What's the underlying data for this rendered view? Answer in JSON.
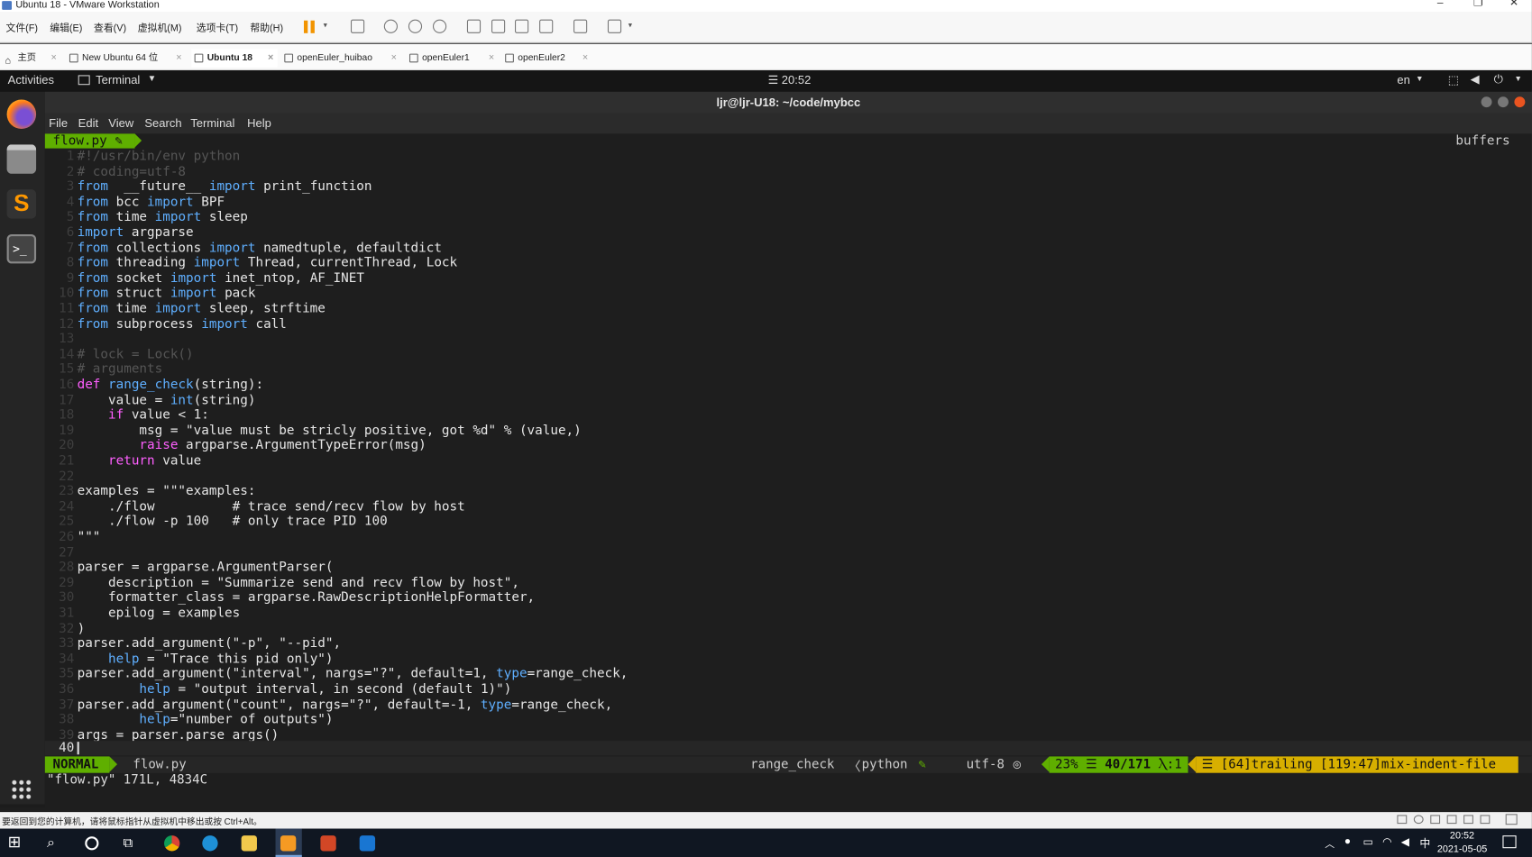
{
  "window": {
    "title": "Ubuntu 18 - VMware Workstation"
  },
  "vm_menu": [
    "文件(F)",
    "编辑(E)",
    "查看(V)",
    "虚拟机(M)",
    "选项卡(T)",
    "帮助(H)"
  ],
  "vm_tabs": [
    {
      "label": "主页"
    },
    {
      "label": "New Ubuntu 64 位"
    },
    {
      "label": "Ubuntu 18"
    },
    {
      "label": "openEuler_huibao"
    },
    {
      "label": "openEuler1"
    },
    {
      "label": "openEuler2"
    }
  ],
  "gnome": {
    "activities": "Activities",
    "app": "Terminal",
    "clock": "20:52",
    "lang": "en"
  },
  "terminal": {
    "title": "ljr@ljr-U18: ~/code/mybcc",
    "menu": [
      "File",
      "Edit",
      "View",
      "Search",
      "Terminal",
      "Help"
    ]
  },
  "vim": {
    "tab": "flow.py",
    "buffers_label": "buffers",
    "mode": "NORMAL",
    "filename": "flow.py",
    "func": "range_check",
    "filetype": "python",
    "encoding": "utf-8",
    "percent": "23%",
    "position": "40/171",
    "col": ":1",
    "warnings": "[64]trailing [119:47]mix-indent-file",
    "cmdline": "\"flow.py\" 171L, 4834C",
    "cursor_line": "40"
  },
  "code_lines": [
    {
      "n": "1",
      "t": "#!/usr/bin/env python",
      "c": "cm"
    },
    {
      "n": "2",
      "t": "# coding=utf-8",
      "c": "cm"
    },
    {
      "n": "3",
      "parts": [
        [
          "kw",
          "from"
        ],
        [
          "",
          "  __future__ "
        ],
        [
          "kw",
          "import"
        ],
        [
          "",
          " print_function"
        ]
      ]
    },
    {
      "n": "4",
      "parts": [
        [
          "kw",
          "from"
        ],
        [
          "",
          " bcc "
        ],
        [
          "kw",
          "import"
        ],
        [
          "",
          " BPF"
        ]
      ]
    },
    {
      "n": "5",
      "parts": [
        [
          "kw",
          "from"
        ],
        [
          "",
          " time "
        ],
        [
          "kw",
          "import"
        ],
        [
          "",
          " sleep"
        ]
      ]
    },
    {
      "n": "6",
      "parts": [
        [
          "kw",
          "import"
        ],
        [
          "",
          " argparse"
        ]
      ]
    },
    {
      "n": "7",
      "parts": [
        [
          "kw",
          "from"
        ],
        [
          "",
          " collections "
        ],
        [
          "kw",
          "import"
        ],
        [
          "",
          " namedtuple, defaultdict"
        ]
      ]
    },
    {
      "n": "8",
      "parts": [
        [
          "kw",
          "from"
        ],
        [
          "",
          " threading "
        ],
        [
          "kw",
          "import"
        ],
        [
          "",
          " Thread, currentThread, Lock"
        ]
      ]
    },
    {
      "n": "9",
      "parts": [
        [
          "kw",
          "from"
        ],
        [
          "",
          " socket "
        ],
        [
          "kw",
          "import"
        ],
        [
          "",
          " inet_ntop, AF_INET"
        ]
      ]
    },
    {
      "n": "10",
      "parts": [
        [
          "kw",
          "from"
        ],
        [
          "",
          " struct "
        ],
        [
          "kw",
          "import"
        ],
        [
          "",
          " pack"
        ]
      ]
    },
    {
      "n": "11",
      "parts": [
        [
          "kw",
          "from"
        ],
        [
          "",
          " time "
        ],
        [
          "kw",
          "import"
        ],
        [
          "",
          " sleep, strftime"
        ]
      ]
    },
    {
      "n": "12",
      "parts": [
        [
          "kw",
          "from"
        ],
        [
          "",
          " subprocess "
        ],
        [
          "kw",
          "import"
        ],
        [
          "",
          " call"
        ]
      ]
    },
    {
      "n": "13",
      "t": "",
      "c": ""
    },
    {
      "n": "14",
      "t": "# lock = Lock()",
      "c": "cm"
    },
    {
      "n": "15",
      "t": "# arguments",
      "c": "cm"
    },
    {
      "n": "16",
      "parts": [
        [
          "kw2",
          "def"
        ],
        [
          "",
          " "
        ],
        [
          "bi",
          "range_check"
        ],
        [
          "",
          "(string):"
        ]
      ]
    },
    {
      "n": "17",
      "parts": [
        [
          "",
          "    value = "
        ],
        [
          "bi",
          "int"
        ],
        [
          "",
          "(string)"
        ]
      ]
    },
    {
      "n": "18",
      "parts": [
        [
          "",
          "    "
        ],
        [
          "kw2",
          "if"
        ],
        [
          "",
          " value < 1:"
        ]
      ]
    },
    {
      "n": "19",
      "t": "        msg = \"value must be stricly positive, got %d\" % (value,)",
      "c": ""
    },
    {
      "n": "20",
      "parts": [
        [
          "",
          "        "
        ],
        [
          "kw2",
          "raise"
        ],
        [
          "",
          " argparse.ArgumentTypeError(msg)"
        ]
      ]
    },
    {
      "n": "21",
      "parts": [
        [
          "",
          "    "
        ],
        [
          "kw2",
          "return"
        ],
        [
          "",
          " value"
        ]
      ]
    },
    {
      "n": "22",
      "t": "",
      "c": ""
    },
    {
      "n": "23",
      "t": "examples = \"\"\"examples:",
      "c": ""
    },
    {
      "n": "24",
      "t": "    ./flow          # trace send/recv flow by host",
      "c": ""
    },
    {
      "n": "25",
      "t": "    ./flow -p 100   # only trace PID 100",
      "c": ""
    },
    {
      "n": "26",
      "t": "\"\"\"",
      "c": ""
    },
    {
      "n": "27",
      "t": "",
      "c": ""
    },
    {
      "n": "28",
      "t": "parser = argparse.ArgumentParser(",
      "c": ""
    },
    {
      "n": "29",
      "t": "    description = \"Summarize send and recv flow by host\",",
      "c": ""
    },
    {
      "n": "30",
      "t": "    formatter_class = argparse.RawDescriptionHelpFormatter,",
      "c": ""
    },
    {
      "n": "31",
      "t": "    epilog = examples",
      "c": ""
    },
    {
      "n": "32",
      "t": ")",
      "c": ""
    },
    {
      "n": "33",
      "t": "parser.add_argument(\"-p\", \"--pid\",",
      "c": ""
    },
    {
      "n": "34",
      "parts": [
        [
          "",
          "    "
        ],
        [
          "kw",
          "help"
        ],
        [
          "",
          " = \"Trace this pid only\")"
        ]
      ]
    },
    {
      "n": "35",
      "parts": [
        [
          "",
          "parser.add_argument(\"interval\", nargs=\"?\", default=1, "
        ],
        [
          "kw",
          "type"
        ],
        [
          "",
          "=range_check,"
        ]
      ]
    },
    {
      "n": "36",
      "parts": [
        [
          "",
          "        "
        ],
        [
          "kw",
          "help"
        ],
        [
          "",
          " = \"output interval, in second (default 1)\")"
        ]
      ]
    },
    {
      "n": "37",
      "parts": [
        [
          "",
          "parser.add_argument(\"count\", nargs=\"?\", default=-1, "
        ],
        [
          "kw",
          "type"
        ],
        [
          "",
          "=range_check,"
        ]
      ]
    },
    {
      "n": "38",
      "parts": [
        [
          "",
          "        "
        ],
        [
          "kw",
          "help"
        ],
        [
          "",
          "=\"number of outputs\")"
        ]
      ]
    },
    {
      "n": "39",
      "t": "args = parser.parse_args()",
      "c": ""
    }
  ],
  "win_status": "要返回到您的计算机，请将鼠标指针从虚拟机中移出或按 Ctrl+Alt。",
  "taskbar": {
    "time": "20:52",
    "date": "2021-05-05",
    "ime": "中"
  },
  "colors": {
    "accent_green": "#5faf00",
    "vim_bg": "#1e1e1e",
    "keyword": "#5fafff",
    "keyword2": "#ff5fff"
  }
}
